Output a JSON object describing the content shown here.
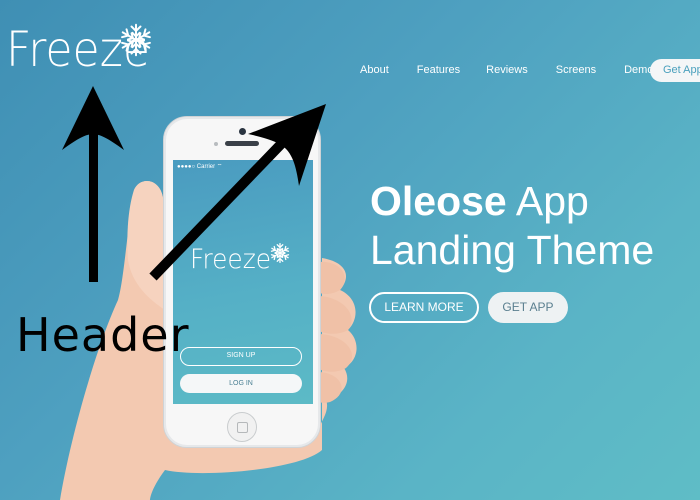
{
  "header": {
    "logo_text": "Freeze",
    "logo_icon": "snowflake-icon"
  },
  "nav": {
    "items": [
      "About",
      "Features",
      "Reviews",
      "Screens",
      "Demo"
    ],
    "cta": "Get App"
  },
  "hero": {
    "title_bold": "Oleose",
    "title_rest": " App",
    "title_line2": "Landing Theme",
    "primary_button": "LEARN MORE",
    "secondary_button": "GET APP"
  },
  "phone": {
    "status_text": "●●●●○ Carrier  ⌔",
    "app_logo": "Freeze",
    "signup": "SIGN UP",
    "login": "LOG IN"
  },
  "annotation": {
    "label": "Header"
  },
  "colors": {
    "background_start": "#3f8fb4",
    "background_end": "#5fbdc6",
    "accent": "#4aa0bd",
    "annotation": "#000000"
  }
}
